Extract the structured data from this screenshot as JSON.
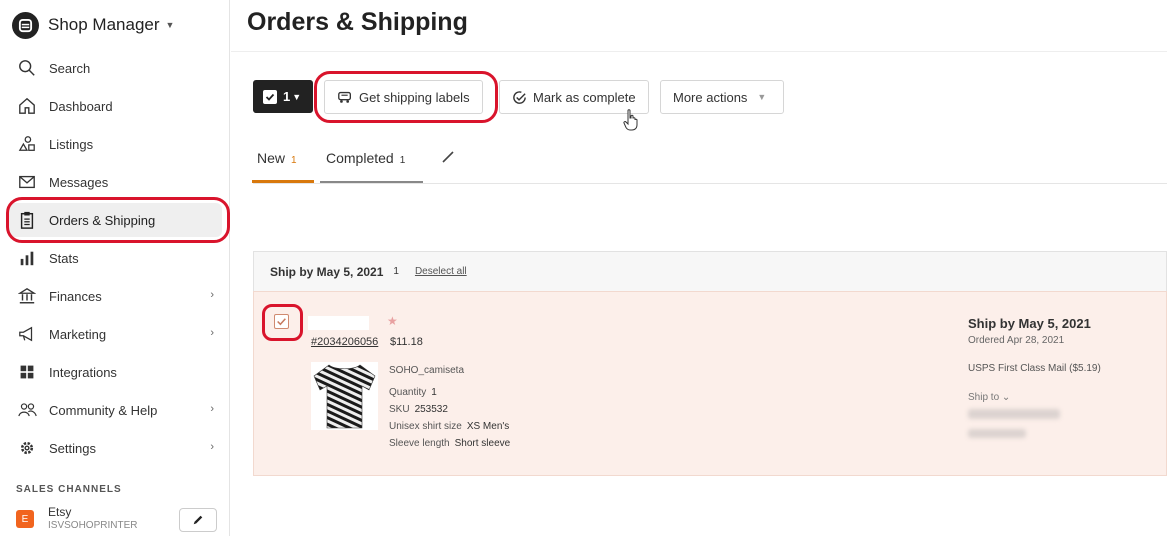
{
  "sidebar": {
    "title": "Shop Manager",
    "items": [
      {
        "label": "Search",
        "icon": "search-icon"
      },
      {
        "label": "Dashboard",
        "icon": "home-icon"
      },
      {
        "label": "Listings",
        "icon": "shapes-icon"
      },
      {
        "label": "Messages",
        "icon": "envelope-icon"
      },
      {
        "label": "Orders & Shipping",
        "icon": "clipboard-icon",
        "active": true
      },
      {
        "label": "Stats",
        "icon": "bar-chart-icon"
      },
      {
        "label": "Finances",
        "icon": "bank-icon",
        "has_submenu": true
      },
      {
        "label": "Marketing",
        "icon": "megaphone-icon",
        "has_submenu": true
      },
      {
        "label": "Integrations",
        "icon": "grid-icon"
      },
      {
        "label": "Community & Help",
        "icon": "people-icon",
        "has_submenu": true
      },
      {
        "label": "Settings",
        "icon": "gear-icon",
        "has_submenu": true
      }
    ],
    "sales_channels_title": "SALES CHANNELS",
    "channel": {
      "badge": "E",
      "name": "Etsy",
      "shop": "ISVSOHOPRINTER"
    }
  },
  "page": {
    "title": "Orders & Shipping"
  },
  "toolbar": {
    "selected_count": "1",
    "shipping_labels": "Get shipping labels",
    "mark_complete": "Mark as complete",
    "more_actions": "More actions"
  },
  "tabs": {
    "new_label": "New",
    "new_count": "1",
    "completed_label": "Completed",
    "completed_count": "1"
  },
  "group": {
    "title": "Ship by May 5, 2021",
    "count": "1",
    "deselect": "Deselect all"
  },
  "order": {
    "id": "#2034206056",
    "price": "$11.18",
    "item_name": "SOHO_camiseta",
    "quantity_label": "Quantity",
    "quantity": "1",
    "sku_label": "SKU",
    "sku": "253532",
    "size_label": "Unisex shirt size",
    "size": "XS Men's",
    "sleeve_label": "Sleeve length",
    "sleeve": "Short sleeve",
    "ship_by": "Ship by May 5, 2021",
    "ordered": "Ordered Apr 28, 2021",
    "carrier": "USPS First Class Mail ($5.19)",
    "ship_to": "Ship to"
  },
  "colors": {
    "accent": "#f1641e",
    "highlight": "#d9142c",
    "tab_active": "#d8780c"
  }
}
